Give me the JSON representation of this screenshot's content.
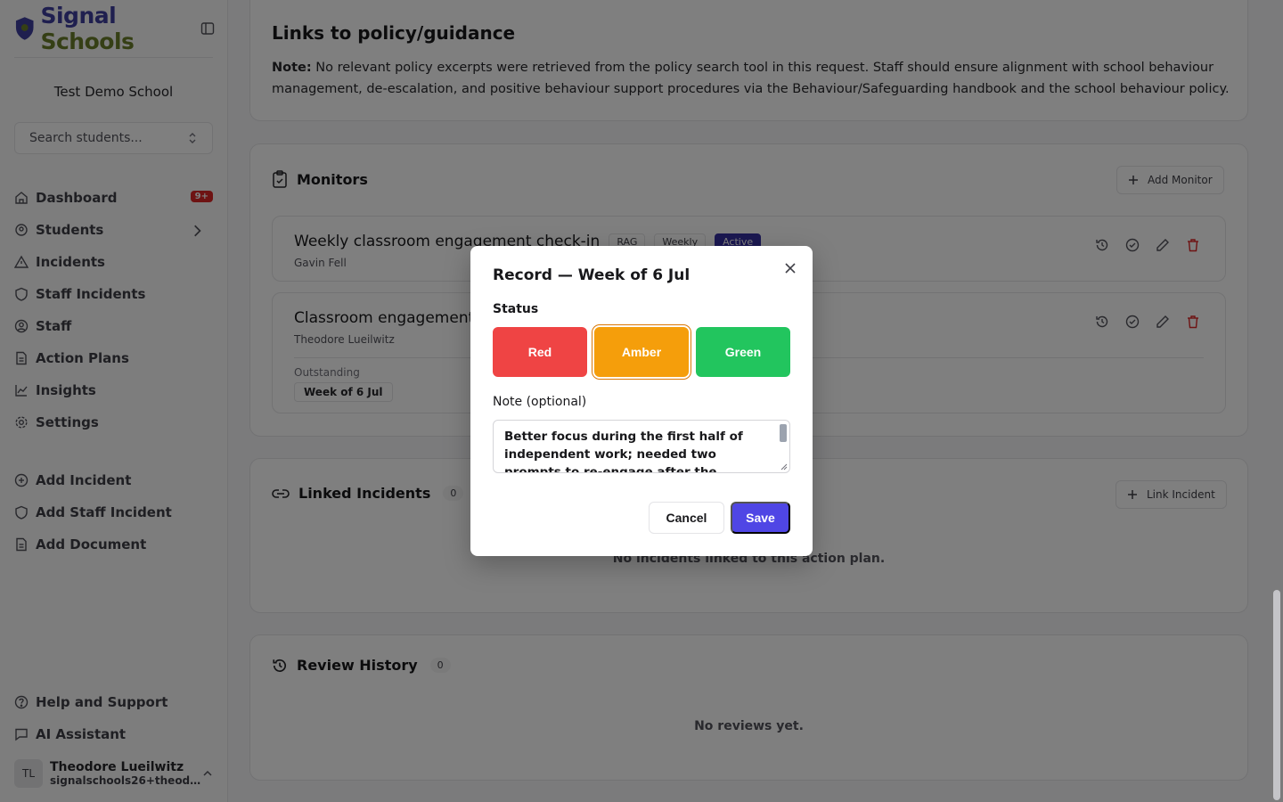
{
  "brand": {
    "name_a": "Signal",
    "name_b": "Schools"
  },
  "sidebar": {
    "school": "Test Demo School",
    "search_placeholder": "Search students...",
    "nav": [
      {
        "label": "Dashboard",
        "icon": "home-icon",
        "badge": "9+"
      },
      {
        "label": "Students",
        "icon": "students-icon"
      },
      {
        "label": "Incidents",
        "icon": "alert-triangle-icon"
      },
      {
        "label": "Staff Incidents",
        "icon": "shield-icon"
      },
      {
        "label": "Staff",
        "icon": "user-circle-icon"
      },
      {
        "label": "Action Plans",
        "icon": "file-icon"
      },
      {
        "label": "Insights",
        "icon": "chart-icon"
      },
      {
        "label": "Settings",
        "icon": "gear-icon"
      }
    ],
    "quick": [
      {
        "label": "Add Incident",
        "icon": "plus-circle-icon"
      },
      {
        "label": "Add Staff Incident",
        "icon": "shield-icon"
      },
      {
        "label": "Add Document",
        "icon": "file-icon"
      }
    ],
    "footer": [
      {
        "label": "Help and Support",
        "icon": "help-icon"
      },
      {
        "label": "AI Assistant",
        "icon": "chat-icon"
      }
    ],
    "user": {
      "initials": "TL",
      "name": "Theodore Lueilwitz",
      "email": "signalschools26+theodo..."
    }
  },
  "policy": {
    "title": "Links to policy/guidance",
    "note_label": "Note:",
    "note_text": " No relevant policy excerpts were retrieved from the policy search tool in this request. Staff should ensure alignment with school behaviour management, de-escalation, and positive behaviour support procedures via the Behaviour/Safeguarding handbook and the school behaviour policy."
  },
  "monitors": {
    "title": "Monitors",
    "add_label": "Add Monitor",
    "items": [
      {
        "title": "Weekly classroom engagement check-in",
        "type": "RAG",
        "freq": "Weekly",
        "status": "Active",
        "owner": "Gavin Fell"
      },
      {
        "title": "Classroom engagement",
        "owner": "Theodore Lueilwitz",
        "outstanding_label": "Outstanding",
        "outstanding_week": "Week of 6 Jul"
      }
    ]
  },
  "linked": {
    "title": "Linked Incidents",
    "count": "0",
    "add_label": "Link Incident",
    "empty": "No incidents linked to this action plan."
  },
  "reviews": {
    "title": "Review History",
    "count": "0",
    "empty": "No reviews yet."
  },
  "dialog": {
    "title": "Record — Week of 6 Jul",
    "status_label": "Status",
    "options": [
      "Red",
      "Amber",
      "Green"
    ],
    "selected": "Amber",
    "note_label": "Note (optional)",
    "note_value": "Better focus during the first half of independent work; needed two prompts to re-engage after the transition.",
    "cancel": "Cancel",
    "save": "Save",
    "colors": {
      "red": "#ef4444",
      "amber": "#f59e0b",
      "green": "#22c55e",
      "primary": "#4f46e5"
    }
  }
}
